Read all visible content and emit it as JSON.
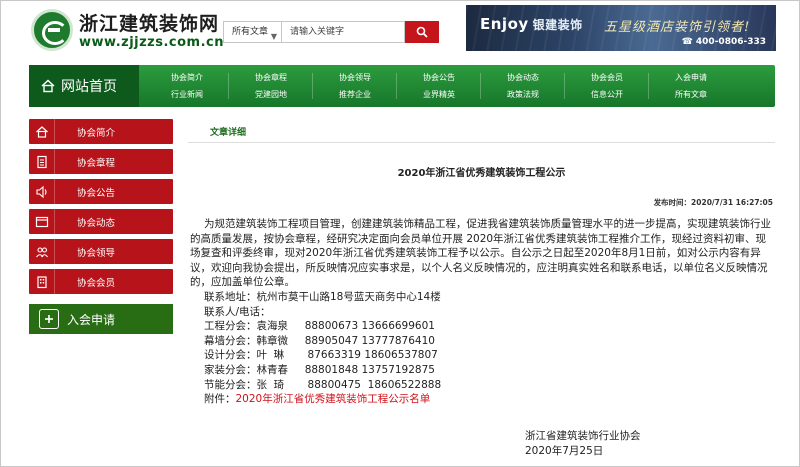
{
  "header": {
    "site_name": "浙江建筑装饰网",
    "site_url": "www.zjjzzs.com.cn",
    "search": {
      "scope": "所有文章",
      "placeholder": "请输入关键字"
    },
    "banner": {
      "brand": "Enjoy",
      "brand_cn": "银建装饰",
      "slogan": "五星级酒店装饰引领者!",
      "phone": "400-0806-333"
    }
  },
  "nav": {
    "home": "网站首页",
    "columns": [
      [
        "协会简介",
        "行业新闻"
      ],
      [
        "协会章程",
        "党建园地"
      ],
      [
        "协会领导",
        "推荐企业"
      ],
      [
        "协会公告",
        "业界精英"
      ],
      [
        "协会动态",
        "政策法规"
      ],
      [
        "协会会员",
        "信息公开"
      ],
      [
        "入会申请",
        "所有文章"
      ]
    ]
  },
  "sidebar": {
    "items": [
      {
        "label": "协会简介",
        "icon": "home-icon"
      },
      {
        "label": "协会章程",
        "icon": "document-icon"
      },
      {
        "label": "协会公告",
        "icon": "speaker-icon"
      },
      {
        "label": "协会动态",
        "icon": "window-icon"
      },
      {
        "label": "协会领导",
        "icon": "users-icon"
      },
      {
        "label": "协会会员",
        "icon": "building-icon"
      }
    ],
    "join": "入会申请"
  },
  "content": {
    "section_tab": "文章详细",
    "title": "2020年浙江省优秀建筑装饰工程公示",
    "published": "发布时间：2020/7/31 16:27:05",
    "paragraph": "为规范建筑装饰工程项目管理，创建建筑装饰精品工程，促进我省建筑装饰质量管理水平的进一步提高，实现建筑装饰行业的高质量发展，按协会章程，经研究决定面向会员单位开展 2020年浙江省优秀建筑装饰工程推介工作，现经过资料初审、现场复查和评委终审，现对2020年浙江省优秀建筑装饰工程予以公示。自公示之日起至2020年8月1日前，如对公示内容有异议，欢迎向我协会提出，所反映情况应实事求是，以个人名义反映情况的，应注明真实姓名和联系电话，以单位名义反映情况的，应加盖单位公章。",
    "address": "联系地址：杭州市莫干山路18号蓝天商务中心14楼",
    "contact_label": "联系人/电话：",
    "contacts": [
      "工程分会：袁海泉     88800673 13666699601",
      "幕墙分会：韩章微     88905047 13777876410",
      "设计分会：叶  琳       87663319 18606537807",
      "家装分会：林青春     88801848 13757192875",
      "节能分会：张  琦       88800475  18606522888"
    ],
    "attachment_label": "附件：",
    "attachment_link": "2020年浙江省优秀建筑装饰工程公示名单",
    "signature": "浙江省建筑装饰行业协会",
    "sign_date": "2020年7月25日"
  },
  "colors": {
    "nav_green": "#17762a",
    "sidebar_red": "#b7131a",
    "join_green": "#286d14",
    "link_red": "#d0121a"
  }
}
